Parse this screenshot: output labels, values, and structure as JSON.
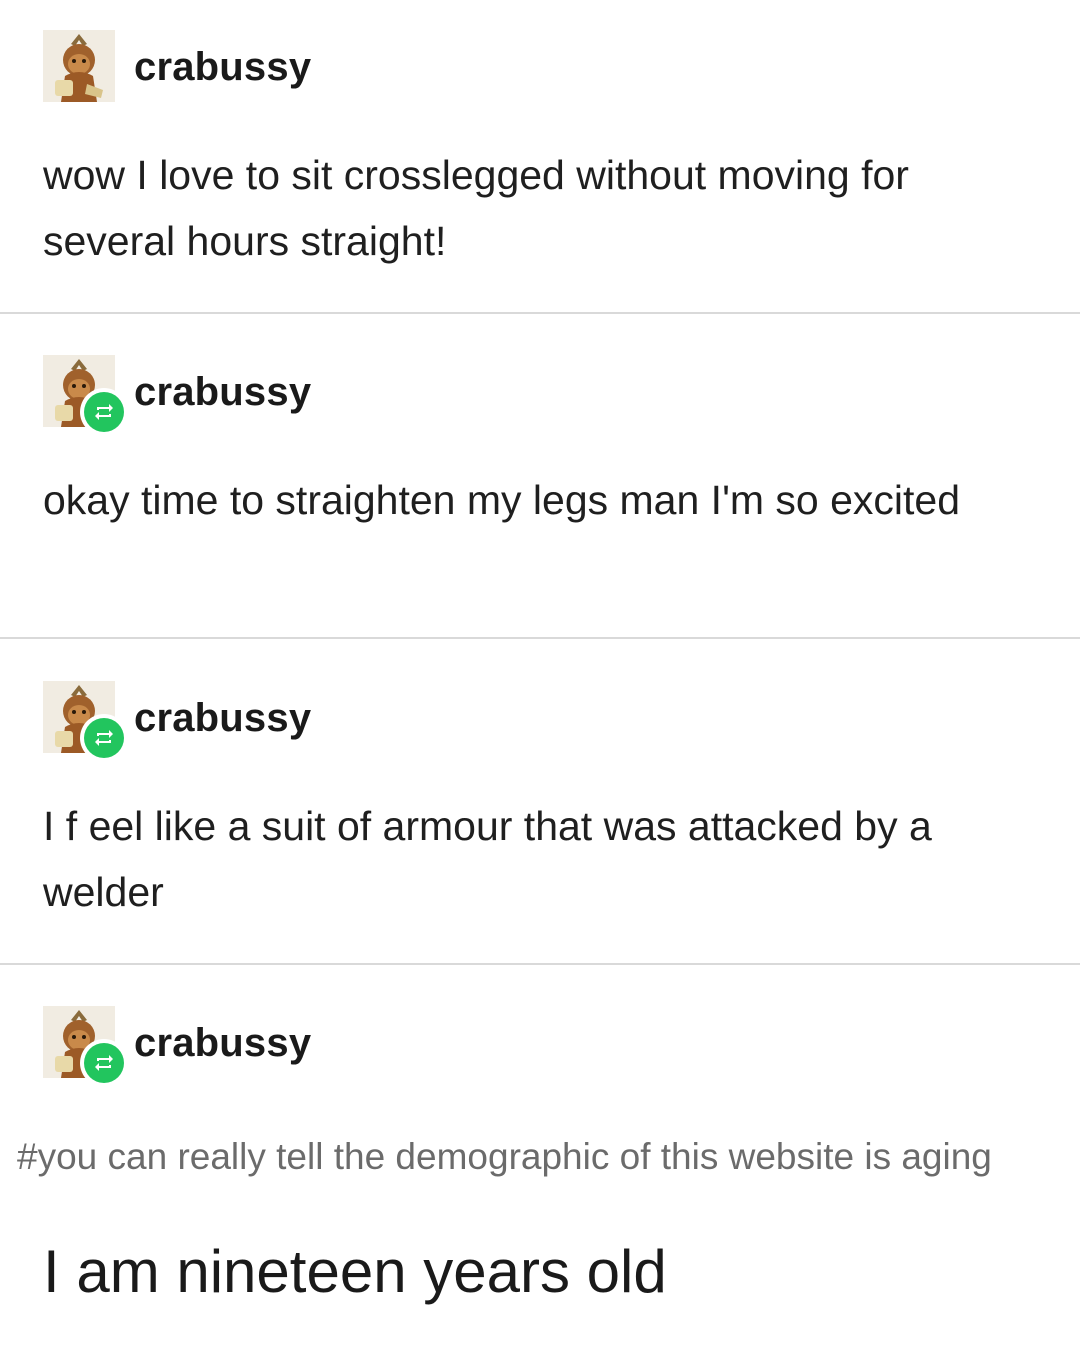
{
  "posts": [
    {
      "username": "crabussy",
      "text": "wow I love to sit crosslegged without moving for several hours straight!",
      "reblog": false
    },
    {
      "username": "crabussy",
      "text": "okay time to straighten my legs man I'm so excited",
      "reblog": true
    },
    {
      "username": "crabussy",
      "text": "I f eel like a suit of armour that  was attacked by a welder",
      "reblog": true
    },
    {
      "username": "crabussy",
      "reblog": true
    }
  ],
  "tags": [
    "#you can really tell the demographic of this website is aging"
  ],
  "caption": "I am nineteen years old",
  "colors": {
    "reblog_badge": "#22c55e",
    "divider": "#d9d9d9",
    "tag_text": "#6b6b6b"
  },
  "icons": {
    "avatar": "avatar-icon",
    "reblog": "reblog-icon"
  }
}
